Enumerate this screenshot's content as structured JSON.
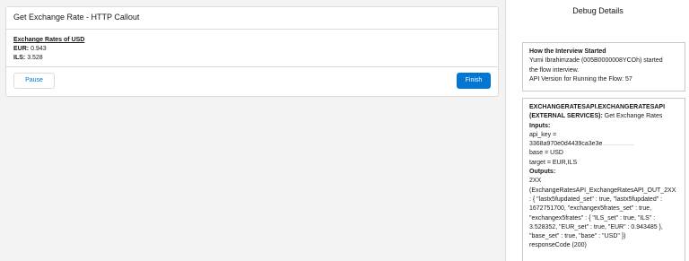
{
  "flow": {
    "title": "Get Exchange Rate - HTTP Callout",
    "rates_title": "Exchange Rates of USD",
    "eur_label": "EUR:",
    "eur_value": "0.943",
    "ils_label": "ILS:",
    "ils_value": "3.528",
    "pause_label": "Pause",
    "finish_label": "Finish"
  },
  "debug": {
    "title": "Debug Details",
    "started": {
      "heading": "How the Interview Started",
      "line1": "Yumi Ibrahimzade (005B0000008YCOh) started",
      "line2": "the flow interview.",
      "line3": "API Version for Running the Flow: 57"
    },
    "callout": {
      "heading_bold1": "EXCHANGERATESAPI.EXCHANGERATESAPI",
      "heading_bold2": "(EXTERNAL SERVICES):",
      "heading_rest": " Get Exchange Rates",
      "inputs_label": "Inputs:",
      "api_key_label": "api_key =",
      "api_key_value": "3368a970e0d4439ca3e3e",
      "base": "base = USD",
      "target": "target = EUR,ILS",
      "outputs_label": "Outputs:",
      "out_2xx": "2XX",
      "out_l1": "(ExchangeRatesAPI_ExchangeRatesAPI_OUT_2XX",
      "out_l2": ": { \"lastx5fupdated_set\" : true, \"lastx5fupdated\" :",
      "out_l3": "1672751700, \"exchangex5frates_set\" : true,",
      "out_l4": "\"exchangex5frates\" : { \"ILS_set\" : true, \"ILS\" :",
      "out_l5": "3.528352, \"EUR_set\" : true, \"EUR\" : 0.943485 },",
      "out_l6": "\"base_set\" : true, \"base\" : \"USD\" })",
      "out_l7": "responseCode (200)"
    }
  }
}
